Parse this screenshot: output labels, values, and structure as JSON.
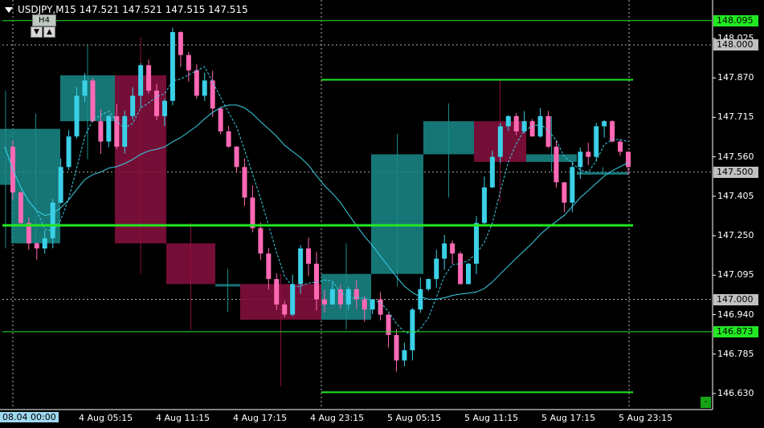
{
  "header": {
    "symbol_line": "USDJPY,M15  147.521 147.521 147.515 147.515",
    "timeframe": "H4",
    "up_button": "▲",
    "down_button": "▼"
  },
  "colors": {
    "background": "#000000",
    "bull_candle": "#3ad0e8",
    "bear_candle": "#ff69b4",
    "h4_bull": "#1a8a8a",
    "h4_bear": "#8a1040",
    "hline": "#22e822",
    "ma": "#3ad0e8"
  },
  "chart_data": {
    "type": "candlestick",
    "symbol": "USDJPY",
    "timeframe": "M15",
    "ylim": [
      146.58,
      148.13
    ],
    "y_ticks": [
      "148.025",
      "147.870",
      "147.715",
      "147.560",
      "147.405",
      "147.250",
      "147.095",
      "146.940",
      "146.785",
      "146.630"
    ],
    "x_ticks": [
      "08.04 00:00",
      "4 Aug 05:15",
      "4 Aug 11:15",
      "4 Aug 17:15",
      "4 Aug 23:15",
      "5 Aug 05:15",
      "5 Aug 11:15",
      "5 Aug 17:15",
      "5 Aug 23:15"
    ],
    "price_labels": [
      {
        "value": "148.095",
        "style": "green"
      },
      {
        "value": "148.000",
        "style": "gray"
      },
      {
        "value": "147.500",
        "style": "gray"
      },
      {
        "value": "147.000",
        "style": "gray"
      },
      {
        "value": "146.873",
        "style": "green"
      }
    ],
    "current_price_hidden_label": "147.515",
    "horizontal_levels": [
      148.095,
      147.863,
      147.291,
      146.873,
      146.635
    ],
    "dotted_levels": [
      148.0,
      147.5,
      147.0
    ],
    "h4_boxes": [
      {
        "open": 147.45,
        "close": 147.67,
        "high": 147.82,
        "low": 147.2,
        "dir": "bull"
      },
      {
        "open": 147.67,
        "close": 147.22,
        "high": 147.73,
        "low": 147.2,
        "dir": "bull"
      },
      {
        "open": 147.7,
        "close": 147.88,
        "high": 148.0,
        "low": 147.55,
        "dir": "bull"
      },
      {
        "open": 147.88,
        "close": 147.22,
        "high": 148.03,
        "low": 147.1,
        "dir": "bear"
      },
      {
        "open": 147.22,
        "close": 147.06,
        "high": 147.3,
        "low": 146.88,
        "dir": "bear"
      },
      {
        "open": 147.06,
        "close": 147.06,
        "high": 147.12,
        "low": 146.95,
        "dir": "bull"
      },
      {
        "open": 147.06,
        "close": 146.92,
        "high": 147.1,
        "low": 146.66,
        "dir": "bear"
      },
      {
        "open": 146.92,
        "close": 147.1,
        "high": 147.22,
        "low": 146.88,
        "dir": "bull"
      },
      {
        "open": 147.1,
        "close": 147.57,
        "high": 147.65,
        "low": 147.05,
        "dir": "bull"
      },
      {
        "open": 147.57,
        "close": 147.7,
        "high": 147.77,
        "low": 147.4,
        "dir": "bull"
      },
      {
        "open": 147.7,
        "close": 147.54,
        "high": 147.86,
        "low": 147.38,
        "dir": "bear"
      },
      {
        "open": 147.54,
        "close": 147.57,
        "high": 147.72,
        "low": 147.5,
        "dir": "bull"
      },
      {
        "open": 147.49,
        "close": 147.5,
        "high": 147.52,
        "low": 147.49,
        "dir": "bull"
      }
    ],
    "m15_path": [
      147.6,
      147.42,
      147.3,
      147.22,
      147.2,
      147.24,
      147.38,
      147.52,
      147.64,
      147.8,
      147.86,
      147.7,
      147.62,
      147.72,
      147.6,
      147.72,
      147.8,
      147.92,
      147.82,
      147.72,
      147.78,
      148.05,
      147.96,
      147.9,
      147.8,
      147.86,
      147.75,
      147.66,
      147.6,
      147.52,
      147.4,
      147.28,
      147.18,
      147.08,
      146.98,
      146.94,
      147.06,
      147.2,
      147.14,
      147.0,
      146.98,
      147.04,
      146.98,
      147.04,
      147.0,
      146.96,
      147.0,
      146.94,
      146.86,
      146.76,
      146.8,
      146.96,
      147.04,
      147.08,
      147.16,
      147.22,
      147.18,
      147.06,
      147.14,
      147.3,
      147.44,
      147.56,
      147.68,
      147.72,
      147.66,
      147.7,
      147.64,
      147.72,
      147.6,
      147.46,
      147.38,
      147.52,
      147.58,
      147.56,
      147.68,
      147.7,
      147.62,
      147.58,
      147.52
    ]
  }
}
